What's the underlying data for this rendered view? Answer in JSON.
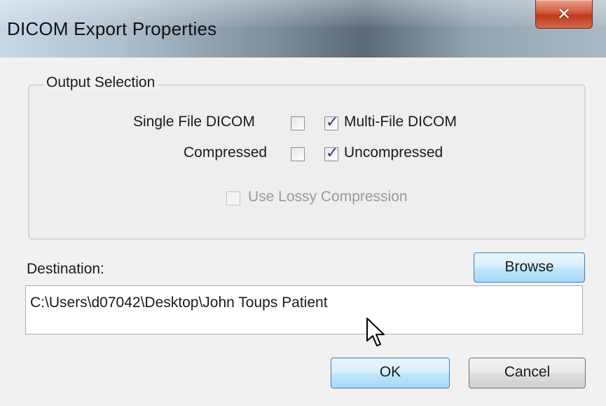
{
  "window": {
    "title": "DICOM Export Properties",
    "close_symbol": "✕"
  },
  "output_selection": {
    "title": "Output Selection",
    "single_file_label": "Single File DICOM",
    "single_file_checked": false,
    "multi_file_label": "Multi-File DICOM",
    "multi_file_checked": true,
    "compressed_label": "Compressed",
    "compressed_checked": false,
    "uncompressed_label": "Uncompressed",
    "uncompressed_checked": true,
    "lossy_label": "Use Lossy Compression",
    "lossy_checked": false,
    "lossy_enabled": false
  },
  "destination": {
    "label": "Destination:",
    "browse_label": "Browse",
    "path_value": "C:\\Users\\d07042\\Desktop\\John Toups Patient"
  },
  "footer": {
    "ok_label": "OK",
    "cancel_label": "Cancel"
  }
}
